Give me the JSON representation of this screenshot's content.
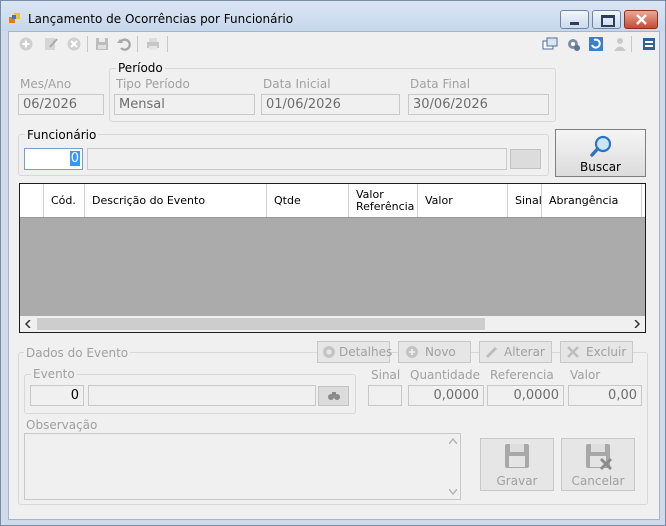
{
  "window": {
    "title": "Lançamento de Ocorrências por Funcionário"
  },
  "mes_ano": {
    "label": "Mes/Ano",
    "value": "06/2026"
  },
  "periodo": {
    "group_label": "Período",
    "tipo_label": "Tipo Período",
    "tipo_value": "Mensal",
    "inicial_label": "Data Inicial",
    "inicial_value": "01/06/2026",
    "final_label": "Data Final",
    "final_value": "30/06/2026"
  },
  "funcionario": {
    "group_label": "Funcionário",
    "code": "0",
    "name": ""
  },
  "buscar": {
    "label": "Buscar"
  },
  "grid": {
    "columns": [
      "Cód.",
      "Descrição do Evento",
      "Qtde",
      "Valor Referência",
      "Valor",
      "Sinal",
      "Abrangência"
    ]
  },
  "dados_evento": {
    "group_label": "Dados do Evento",
    "detalhes": "Detalhes",
    "novo": "Novo",
    "alterar": "Alterar",
    "excluir": "Excluir",
    "evento_label": "Evento",
    "evento_value": "0",
    "evento_desc": "",
    "sinal_label": "Sinal",
    "sinal_value": "",
    "quantidade_label": "Quantidade",
    "quantidade_value": "0,0000",
    "referencia_label": "Referencia",
    "referencia_value": "0,0000",
    "valor_label": "Valor",
    "valor_value": "0,00",
    "observacao_label": "Observação",
    "observacao_value": ""
  },
  "actions": {
    "gravar": "Gravar",
    "cancelar": "Cancelar"
  }
}
